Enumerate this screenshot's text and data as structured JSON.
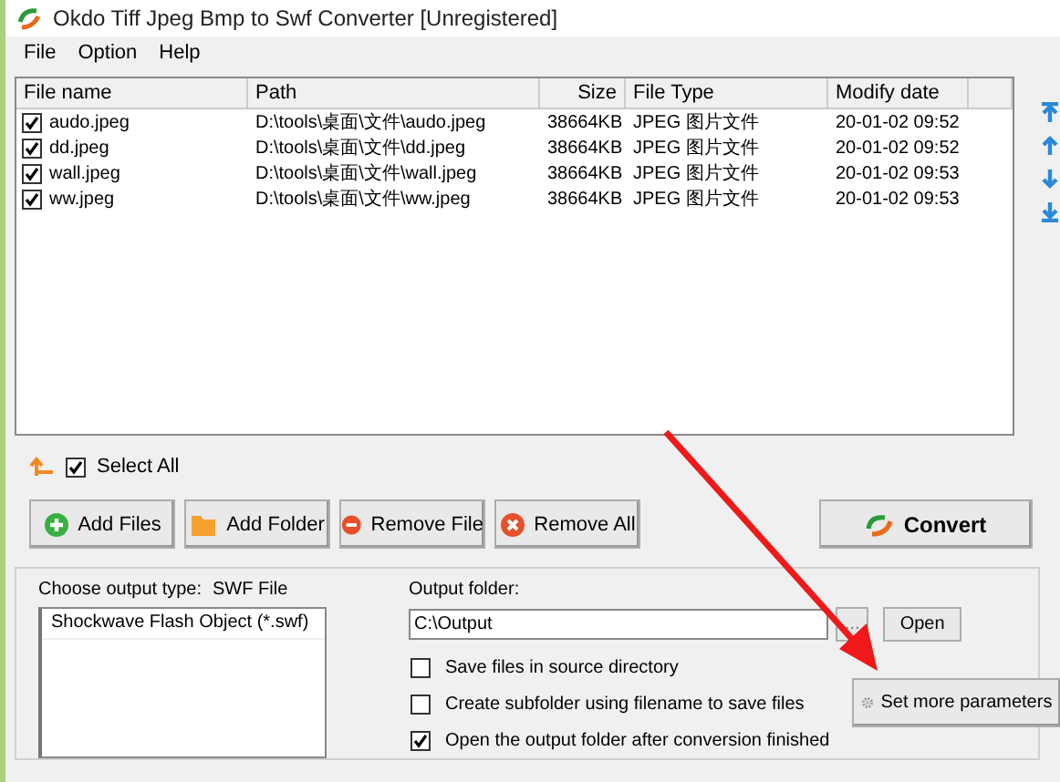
{
  "window": {
    "title": "Okdo Tiff Jpeg Bmp to Swf Converter [Unregistered]"
  },
  "menu": [
    "File",
    "Option",
    "Help"
  ],
  "table": {
    "columns": [
      "File name",
      "Path",
      "Size",
      "File Type",
      "Modify date"
    ],
    "rows": [
      {
        "checked": true,
        "cells": [
          "audo.jpeg",
          "D:\\tools\\桌面\\文件\\audo.jpeg",
          "38664KB",
          "JPEG 图片文件",
          "20-01-02 09:52"
        ]
      },
      {
        "checked": true,
        "cells": [
          "dd.jpeg",
          "D:\\tools\\桌面\\文件\\dd.jpeg",
          "38664KB",
          "JPEG 图片文件",
          "20-01-02 09:52"
        ]
      },
      {
        "checked": true,
        "cells": [
          "wall.jpeg",
          "D:\\tools\\桌面\\文件\\wall.jpeg",
          "38664KB",
          "JPEG 图片文件",
          "20-01-02 09:53"
        ]
      },
      {
        "checked": true,
        "cells": [
          "ww.jpeg",
          "D:\\tools\\桌面\\文件\\ww.jpeg",
          "38664KB",
          "JPEG 图片文件",
          "20-01-02 09:53"
        ]
      }
    ]
  },
  "select_all": {
    "label": "Select All",
    "checked": true
  },
  "buttons": [
    {
      "kind": "add-files",
      "label": "Add Files"
    },
    {
      "kind": "add-folder",
      "label": "Add Folder"
    },
    {
      "kind": "remove-file",
      "label": "Remove File"
    },
    {
      "kind": "remove-all",
      "label": "Remove All"
    }
  ],
  "convert": {
    "label": "Convert"
  },
  "output_type": {
    "label": "Choose output type:",
    "value": "SWF File",
    "options": [
      "Shockwave Flash Object (*.swf)"
    ]
  },
  "output_folder": {
    "label": "Output folder:",
    "value": "C:\\Output",
    "browse": "...",
    "open": "Open"
  },
  "options": [
    {
      "label": "Save files in source directory",
      "checked": false
    },
    {
      "label": "Create subfolder using filename to save files",
      "checked": false
    },
    {
      "label": "Open the output folder after conversion finished",
      "checked": true
    }
  ],
  "more_button": {
    "label": "Set more parameters"
  }
}
